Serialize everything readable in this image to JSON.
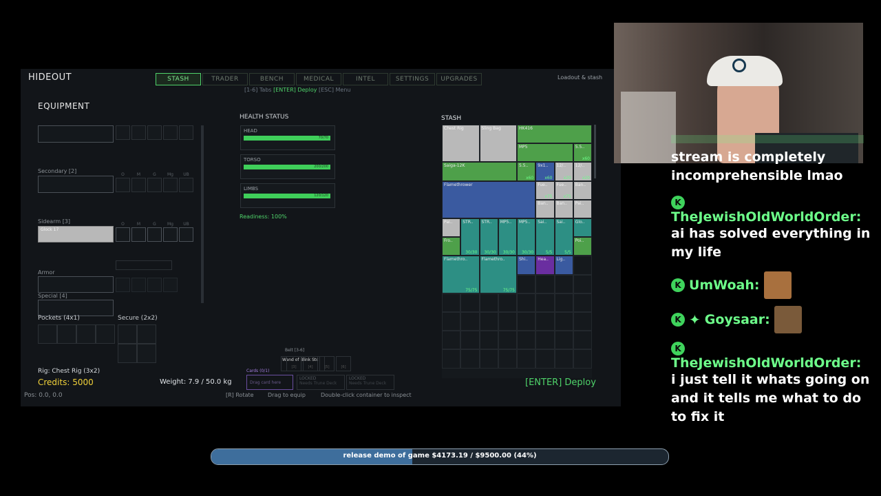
{
  "game": {
    "title": "HIDEOUT",
    "tabs": [
      "STASH",
      "TRADER",
      "BENCH",
      "MEDICAL",
      "INTEL",
      "SETTINGS",
      "UPGRADES"
    ],
    "active_tab": "STASH",
    "right_header": "Loadout & stash",
    "hint_pre": "[1-6] Tabs ",
    "hint_enter": "[ENTER] Deploy",
    "hint_post": " [ESC] Menu",
    "equipment": {
      "title": "EQUIPMENT",
      "secondary_label": "Secondary [2]",
      "sidearm_label": "Sidearm [3]",
      "sidearm_item": "Glock 17",
      "armor_label": "Armor",
      "special_label": "Special [4]",
      "pockets_label": "Pockets (4x1)",
      "secure_label": "Secure (2x2)",
      "attach_labels": [
        "O",
        "M",
        "G",
        "Mg",
        "UB"
      ],
      "rig_label": "Rig: Chest Rig (3x2)",
      "credits": "Credits: 5000",
      "pos": "Pos: 0.0, 0.0"
    },
    "health": {
      "title": "HEALTH STATUS",
      "parts": [
        {
          "name": "HEAD",
          "value": "70/70",
          "fill": 1.0
        },
        {
          "name": "TORSO",
          "value": "200/200",
          "fill": 1.0
        },
        {
          "name": "LIMBS",
          "value": "120/120",
          "fill": 1.0
        }
      ],
      "readiness": "Readiness: 100%"
    },
    "belt": {
      "label": "Belt [3-6]",
      "item": "Wand of Blink Stc",
      "slots": [
        "[3]",
        "[4]",
        "[5]",
        "[6]"
      ]
    },
    "cards": {
      "label": "Cards (0/1)",
      "drop": "Drag card here",
      "locked": "LOCKED",
      "locked_sub": "Needs Trune Deck"
    },
    "weight": "Weight: 7.9 / 50.0 kg",
    "footer_hints": [
      "[R] Rotate",
      "Drag to equip",
      "Double-click container to inspect"
    ],
    "deploy": "[ENTER] Deploy",
    "stash": {
      "title": "STASH",
      "items": [
        {
          "label": "Chest Rig",
          "color": "gray",
          "count": ""
        },
        {
          "label": "Sling Bag",
          "color": "gray",
          "count": ""
        },
        {
          "label": "HK416",
          "color": "green",
          "count": ""
        },
        {
          "label": "MP5",
          "color": "green",
          "count": ""
        },
        {
          "label": "5.5..",
          "color": "green",
          "count": "x60"
        },
        {
          "label": "Saiga-12K",
          "color": "green",
          "count": ""
        },
        {
          "label": "5.5..",
          "color": "green",
          "count": "x60"
        },
        {
          "label": "9x1..",
          "color": "blue",
          "count": "x60"
        },
        {
          "label": "12/..",
          "color": "gray",
          "count": "x20"
        },
        {
          "label": "12/..",
          "color": "gray",
          "count": "x20"
        },
        {
          "label": "Flamethrower",
          "color": "blue",
          "count": ""
        },
        {
          "label": "Fue..",
          "color": "gray",
          "count": "x75"
        },
        {
          "label": "Fue..",
          "color": "gray",
          "count": "x75"
        },
        {
          "label": "Ban..",
          "color": "gray",
          "count": ""
        },
        {
          "label": "Ban..",
          "color": "gray",
          "count": ""
        },
        {
          "label": "Ban..",
          "color": "gray",
          "count": ""
        },
        {
          "label": "Pai..",
          "color": "gray",
          "count": ""
        },
        {
          "label": "Pai..",
          "color": "gray",
          "count": ""
        },
        {
          "label": "STR..",
          "color": "teal",
          "count": "30/30"
        },
        {
          "label": "STR..",
          "color": "teal",
          "count": "30/30"
        },
        {
          "label": "MP5..",
          "color": "teal",
          "count": "30/30"
        },
        {
          "label": "MP5..",
          "color": "teal",
          "count": "30/30"
        },
        {
          "label": "Sai..",
          "color": "teal",
          "count": "5/5"
        },
        {
          "label": "Sai..",
          "color": "teal",
          "count": "5/5"
        },
        {
          "label": "Glo..",
          "color": "teal",
          "count": ""
        },
        {
          "label": "Fro..",
          "color": "green",
          "count": ""
        },
        {
          "label": "Poi..",
          "color": "green",
          "count": ""
        },
        {
          "label": "Flamethro..",
          "color": "teal",
          "count": "75/75"
        },
        {
          "label": "Flamethro..",
          "color": "teal",
          "count": "75/75"
        },
        {
          "label": "Shi..",
          "color": "blue",
          "count": ""
        },
        {
          "label": "Hea..",
          "color": "purple",
          "count": ""
        },
        {
          "label": "Lig..",
          "color": "blue",
          "count": ""
        }
      ]
    }
  },
  "chat": {
    "messages": [
      {
        "user": "",
        "text": "stream is completely incomprehensible lmao"
      },
      {
        "user": "TheJewishOldWorldOrder:",
        "text": "ai has solved everything in my life"
      },
      {
        "user": "UmWoah:",
        "text": ""
      },
      {
        "user": "Goysaar:",
        "text": ""
      },
      {
        "user": "TheJewishOldWorldOrder:",
        "text": "i just tell it whats going on and it tells me what to do to fix it"
      }
    ]
  },
  "goal": {
    "text": "release demo of game $4173.19 / $9500.00 (44%)",
    "progress": 0.44
  },
  "colors": {
    "accent": "#4fd36a",
    "credits": "#f2d23a",
    "chat_name": "#6dff8a"
  }
}
